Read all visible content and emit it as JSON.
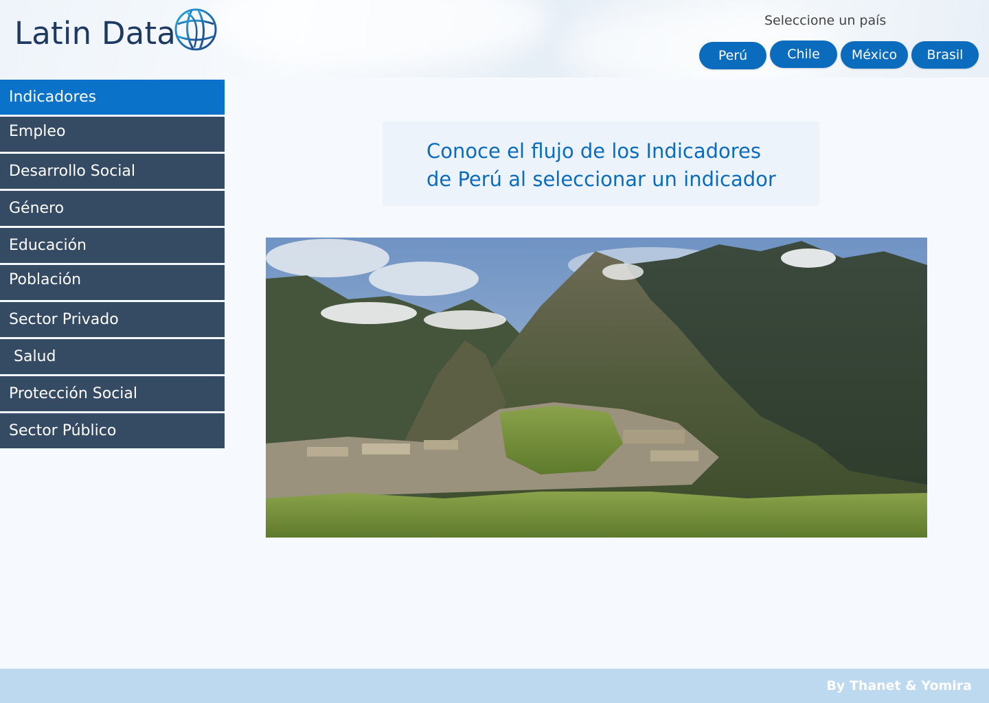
{
  "header": {
    "brand": "Latin Data",
    "logo_icon": "globe-icon",
    "country_prompt": "Seleccione un país",
    "countries": [
      "Perú",
      "Chile",
      "México",
      "Brasil"
    ]
  },
  "nav": {
    "items": [
      {
        "label": "Indicadores",
        "active": true
      },
      {
        "label": "Empleo"
      },
      {
        "label": "Desarrollo Social"
      },
      {
        "label": "Género"
      },
      {
        "label": "Educación"
      },
      {
        "label": "Población"
      },
      {
        "label": "Sector Privado"
      },
      {
        "label": " Salud"
      },
      {
        "label": "Protección Social"
      },
      {
        "label": "Sector Público"
      }
    ]
  },
  "main": {
    "intro_line1": "Conoce el flujo de los Indicadores",
    "intro_line2": "de Perú al seleccionar un indicador"
  },
  "footer": {
    "credit": "By Thanet & Yomira"
  },
  "colors": {
    "accent": "#0b6cbe",
    "nav_bg": "#354a63",
    "nav_active": "#0b72c9",
    "footer_bg": "#bcd9ef"
  }
}
